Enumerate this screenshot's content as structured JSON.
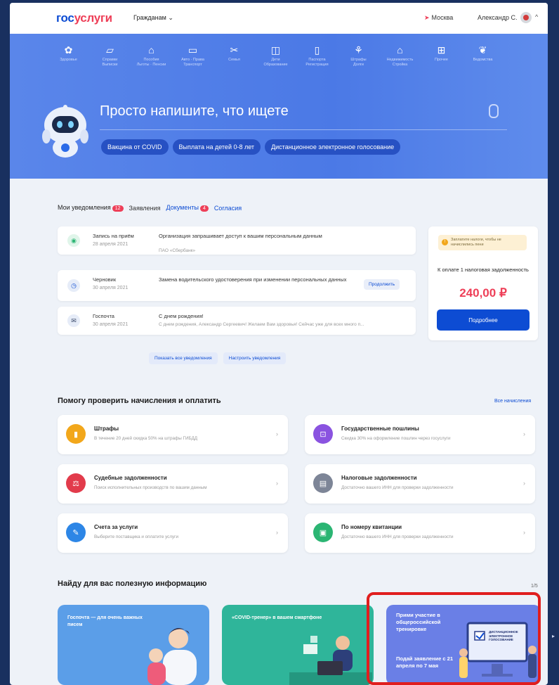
{
  "header": {
    "logo_blue": "гос",
    "logo_red": "услуги",
    "audience": "Гражданам ⌄",
    "city": "Москва",
    "user": "Александр С."
  },
  "categories": [
    {
      "icon": "✿",
      "label": "Здоровье"
    },
    {
      "icon": "▱",
      "label": "Справки\nВыписки"
    },
    {
      "icon": "⌂",
      "label": "Пособия\nЛьготы · Пенсии"
    },
    {
      "icon": "▭",
      "label": "Авто · Права\nТранспорт"
    },
    {
      "icon": "✂",
      "label": "Семья"
    },
    {
      "icon": "◫",
      "label": "Дети\nОбразование"
    },
    {
      "icon": "▯",
      "label": "Паспорта\nРегистрация"
    },
    {
      "icon": "⚘",
      "label": "Штрафы\nДолги"
    },
    {
      "icon": "⌂",
      "label": "Недвижимость\nСтройка"
    },
    {
      "icon": "⊞",
      "label": "Прочее"
    },
    {
      "icon": "❦",
      "label": "Ведомства"
    }
  ],
  "hero": {
    "prompt": "Просто напишите, что ищете",
    "chips": [
      "Вакцина от COVID",
      "Выплата на детей 0-8 лет",
      "Дистанционное электронное голосование"
    ]
  },
  "notifications": {
    "tabs": [
      {
        "label": "Мои уведомления",
        "badge": "12"
      },
      {
        "label": "Заявления",
        "badge": ""
      },
      {
        "label": "Документы",
        "badge": "4"
      },
      {
        "label": "Согласия",
        "badge": ""
      }
    ],
    "items": [
      {
        "type": "Запись на приём",
        "date": "28 апреля 2021",
        "title": "Организация запрашивает доступ к вашим персональным данным",
        "sub": "ПАО «Сбербанк»",
        "button": ""
      },
      {
        "type": "Черновик",
        "date": "30 апреля 2021",
        "title": "Замена водительского удостоверения при изменении персональных данных",
        "sub": "",
        "button": "Продолжить"
      },
      {
        "type": "Госпочта",
        "date": "30 апреля 2021",
        "title": "С днем рождения!",
        "sub": "С днем рождения, Александр Сергеевич! Желаем Вам здоровья! Сейчас уже для всех много п...",
        "button": ""
      }
    ],
    "show_all": "Показать все уведомления",
    "configure": "Настроить уведомления"
  },
  "tax": {
    "warning": "Заплатите налоги, чтобы не начислились пени",
    "title": "К оплате 1 налоговая задолженность",
    "amount": "240,00 ₽",
    "button": "Подробнее"
  },
  "payments": {
    "heading": "Помогу проверить начисления и оплатить",
    "all_link": "Все начисления",
    "items": [
      {
        "title": "Штрафы",
        "sub": "В течение 20 дней скидка 50% на штрафы ГИБДД",
        "color": "#f2a71b",
        "icon": "▮"
      },
      {
        "title": "Государственные пошлины",
        "sub": "Скидка 30% на оформление пошлин через госуслуги",
        "color": "#8a53e0",
        "icon": "⊡"
      },
      {
        "title": "Судебные задолженности",
        "sub": "Поиск исполнительных производств по вашим данным",
        "color": "#e23b4b",
        "icon": "⚖"
      },
      {
        "title": "Налоговые задолженности",
        "sub": "Достаточно вашего ИНН для проверки задолженности",
        "color": "#7d8597",
        "icon": "▤"
      },
      {
        "title": "Счета за услуги",
        "sub": "Выберите поставщика и оплатите услуги",
        "color": "#2d86e6",
        "icon": "✎"
      },
      {
        "title": "По номеру квитанции",
        "sub": "Достаточно вашего ИНН для проверки задолженности",
        "color": "#2bb573",
        "icon": "▣"
      }
    ]
  },
  "info": {
    "heading": "Найду для вас полезную информацию",
    "pager": "1/5",
    "cards": [
      {
        "text": "Госпочта — для очень важных писем",
        "bg": "#5b9ee8"
      },
      {
        "text": "«COVID-тренер» в вашем смартфоне",
        "bg": "#2fb59a"
      },
      {
        "text": "Прими участие в общероссийской тренировке",
        "cta": "Подай заявление с 21 апреля по 7 мая",
        "sign": "ДИСТАНЦИОННОЕ ЭЛЕКТРОННОЕ ГОЛОСОВАНИЕ",
        "bg": "#6a7fe6"
      }
    ]
  }
}
